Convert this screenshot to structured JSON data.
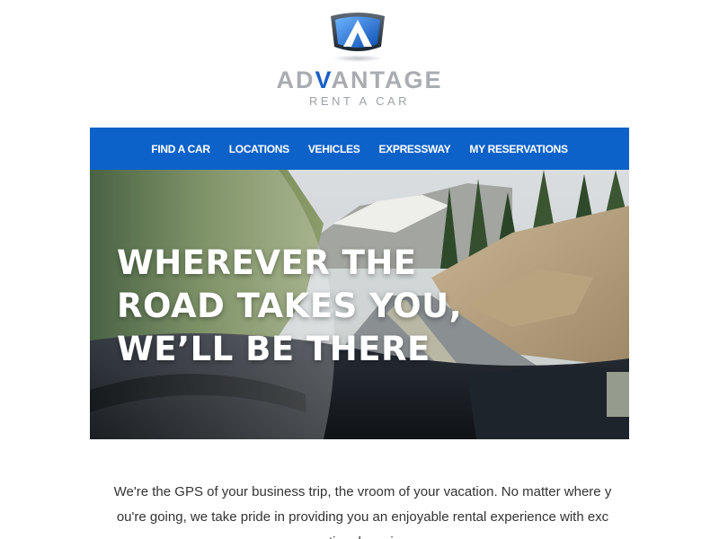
{
  "header": {
    "brand_prefix": "AD",
    "brand_accent": "V",
    "brand_suffix": "ANTAGE",
    "tagline": "RENT A CAR",
    "logo_icon": "advantage-logo-icon"
  },
  "nav": {
    "items": [
      {
        "label": "FIND A CAR"
      },
      {
        "label": "LOCATIONS"
      },
      {
        "label": "VEHICLES"
      },
      {
        "label": "EXPRESSWAY"
      },
      {
        "label": "MY RESERVATIONS"
      }
    ]
  },
  "hero": {
    "lines": [
      "WHEREVER THE",
      "ROAD TAKES YOU,",
      "WE’LL BE THERE"
    ]
  },
  "intro": {
    "text": "We're the GPS of your business trip, the vroom of your vacation. No matter where you're going, we take pride in providing you an enjoyable rental experience with exceptional service."
  },
  "colors": {
    "nav_background": "#0d62c9",
    "brand_gray": "#a9acb0",
    "brand_blue": "#1b5fc6",
    "body_text": "#333333"
  }
}
